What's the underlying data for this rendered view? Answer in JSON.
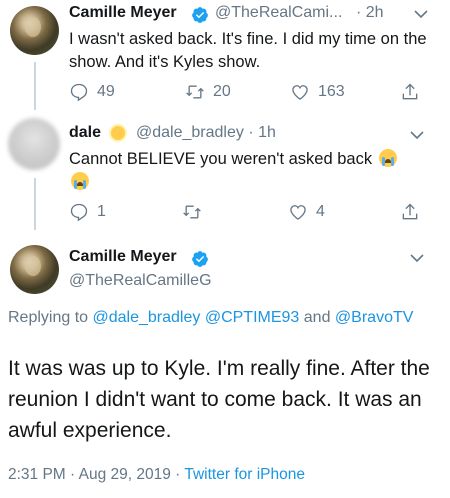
{
  "tweet1": {
    "name": "Camille Meyer",
    "handle": "@TheRealCami...",
    "time": "· 2h",
    "text": "I wasn't asked back. It's fine. I did my time on the show. And it's Kyles show.",
    "reply_count": "49",
    "retweet_count": "20",
    "like_count": "163"
  },
  "tweet2": {
    "name": "dale",
    "handle": "@dale_bradley · 1h",
    "text": "Cannot BELIEVE you weren't asked back",
    "reply_count": "1",
    "like_count": "4"
  },
  "main_tweet": {
    "name": "Camille Meyer",
    "handle": "@TheRealCamilleG",
    "replying_prefix": "Replying to",
    "mention1": "@dale_bradley",
    "mention2": "@CPTIME93",
    "and_word": "and",
    "mention3": "@BravoTV",
    "text": "It was was up to Kyle. I'm really fine. After the reunion I didn't want to come back. It was an awful experience.",
    "timestamp": "2:31 PM · Aug 29, 2019 ·",
    "source": "Twitter for iPhone"
  },
  "icons": [
    "verified-icon",
    "chevron-down-icon",
    "reply-icon",
    "retweet-icon",
    "like-icon",
    "share-icon",
    "angel-emoji",
    "crying-emoji"
  ],
  "colors": {
    "accent": "#1b95e0",
    "muted": "#657786",
    "text": "#14171a",
    "verified": "#1da1f2",
    "line": "#ccd6dd"
  }
}
